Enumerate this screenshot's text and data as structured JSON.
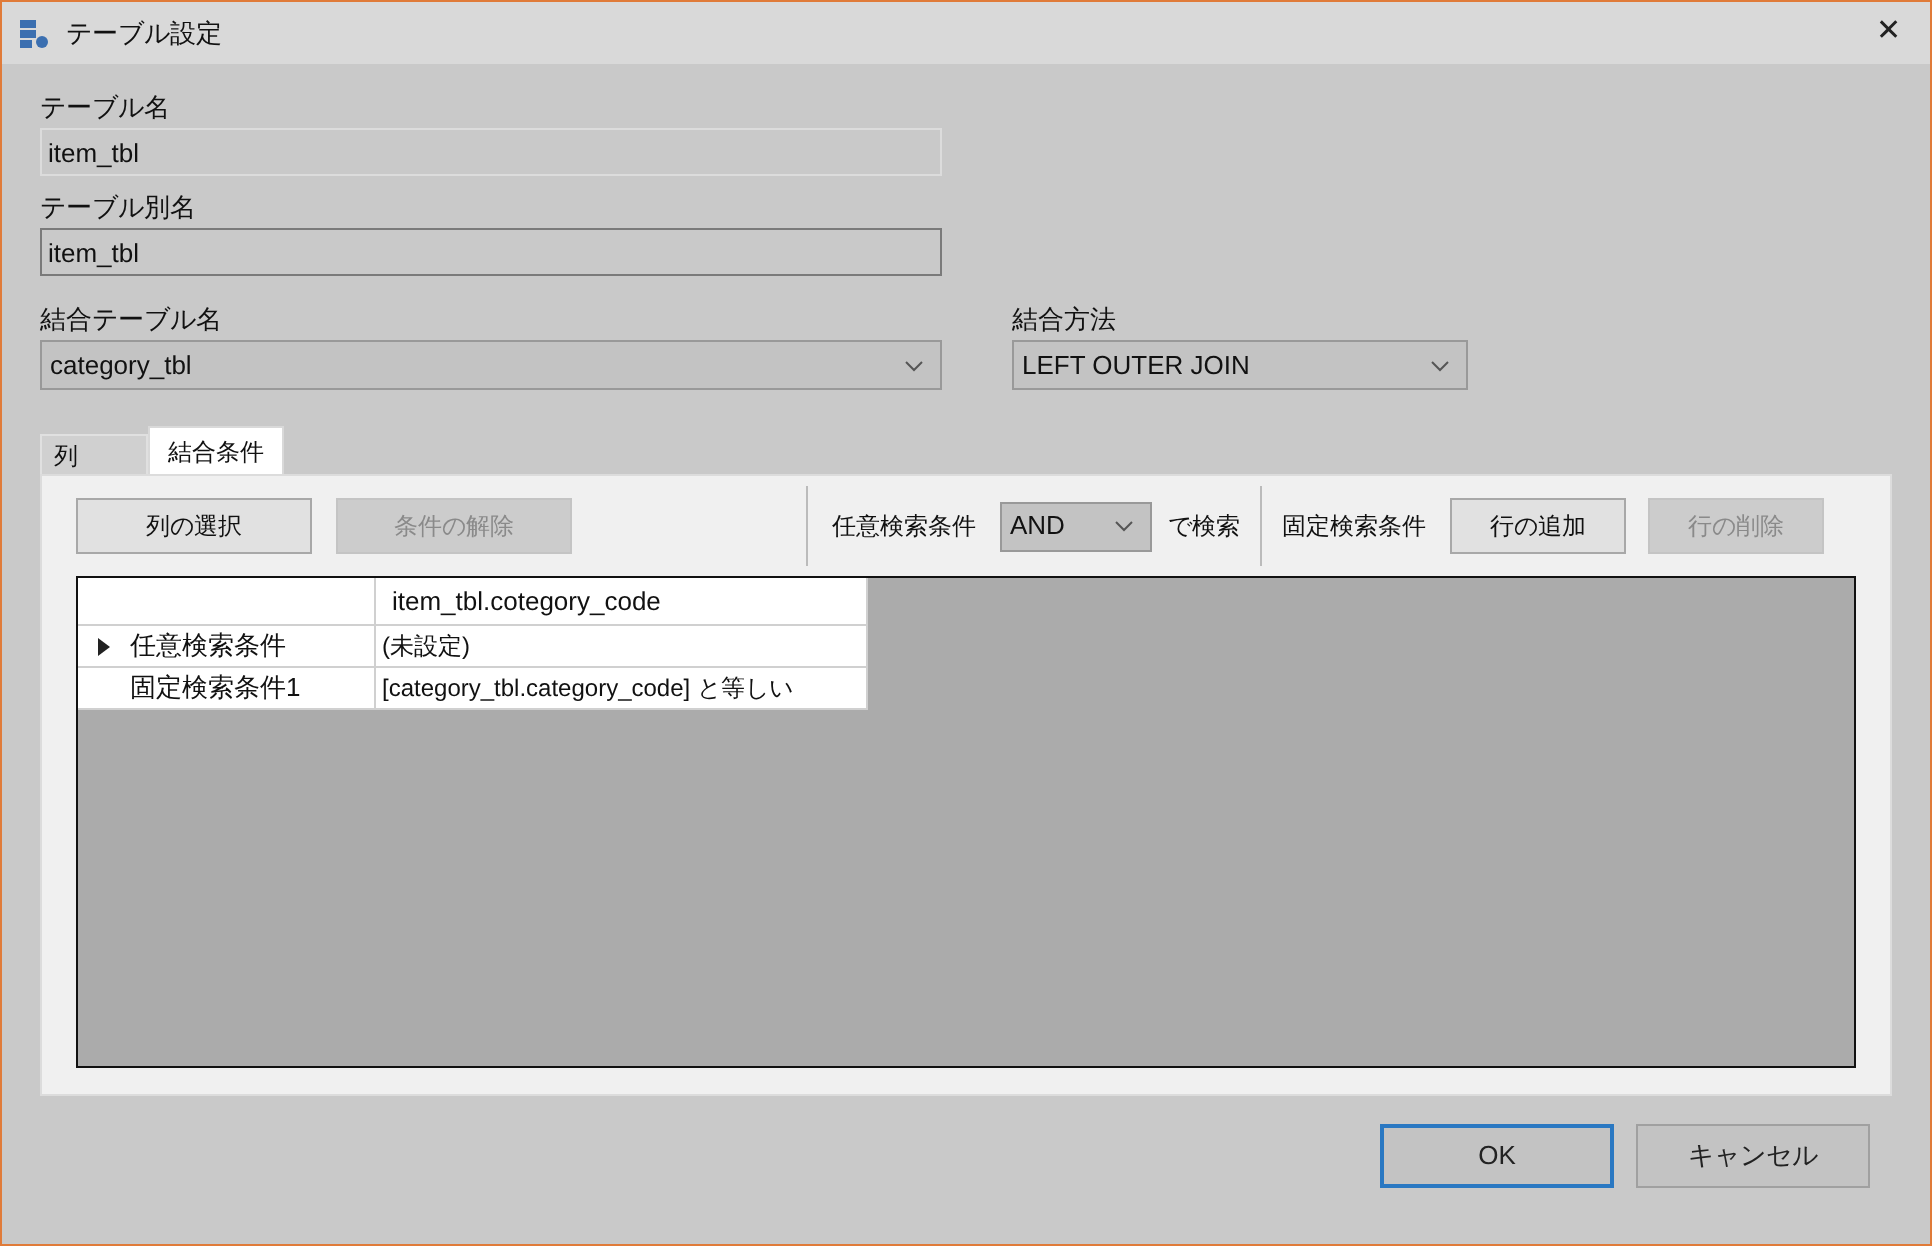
{
  "window": {
    "title": "テーブル設定",
    "close": "✕"
  },
  "fields": [
    {
      "label": "テーブル名",
      "value": "item_tbl",
      "disabled": true
    },
    {
      "label": "テーブル別名",
      "value": "item_tbl",
      "disabled": false
    }
  ],
  "join_table": {
    "label": "結合テーブル名",
    "value": "category_tbl"
  },
  "join_method": {
    "label": "結合方法",
    "value": "LEFT OUTER JOIN"
  },
  "tabs": [
    {
      "label": "列",
      "selected": false
    },
    {
      "label": "結合条件",
      "selected": true
    }
  ],
  "toolbar": {
    "left_buttons": [
      {
        "label": "列の選択",
        "disabled": false
      },
      {
        "label": "条件の解除",
        "disabled": true
      }
    ],
    "optional_label": "任意検索条件",
    "operator": "AND",
    "operator_suffix": "で検索",
    "fixed_label": "固定検索条件",
    "right_buttons": [
      {
        "label": "行の追加",
        "disabled": false
      },
      {
        "label": "行の削除",
        "disabled": true
      }
    ]
  },
  "grid": {
    "columns": [
      "item_tbl.cotegory_code"
    ],
    "rows": [
      {
        "header": "任意検索条件",
        "cell": "(未設定)",
        "selected": true
      },
      {
        "header": "固定検索条件1",
        "cell": "[category_tbl.category_code] と等しい",
        "selected": false
      }
    ]
  },
  "buttons": [
    {
      "label": "OK",
      "default": true
    },
    {
      "label": "キャンセル",
      "default": false
    }
  ]
}
